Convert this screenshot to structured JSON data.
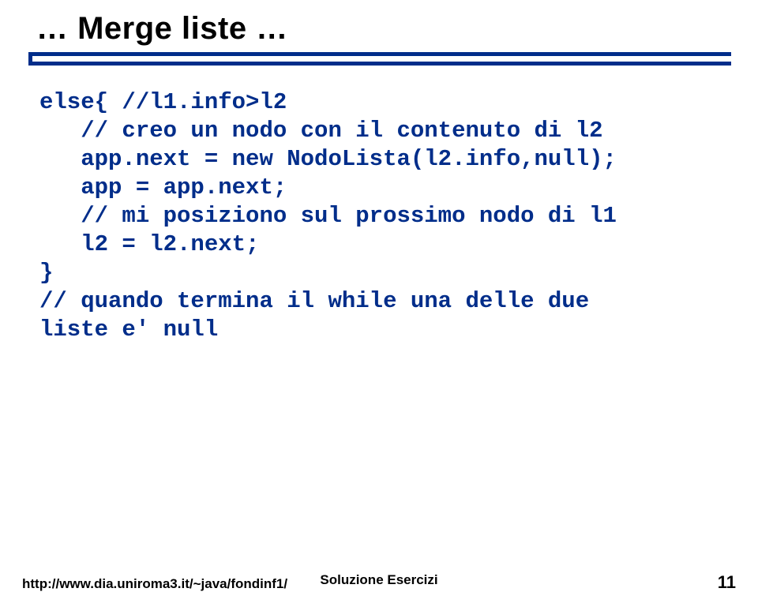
{
  "title": "… Merge liste …",
  "code_lines": [
    "else{ //l1.info>l2",
    "   // creo un nodo con il contenuto di l2",
    "   app.next = new NodoLista(l2.info,null);",
    "   app = app.next;",
    "   // mi posiziono sul prossimo nodo di l1",
    "   l2 = l2.next;",
    "}",
    "// quando termina il while una delle due",
    "liste e' null"
  ],
  "footer": {
    "left": "http://www.dia.uniroma3.it/~java/fondinf1/",
    "center": "Soluzione Esercizi",
    "page": "11"
  }
}
